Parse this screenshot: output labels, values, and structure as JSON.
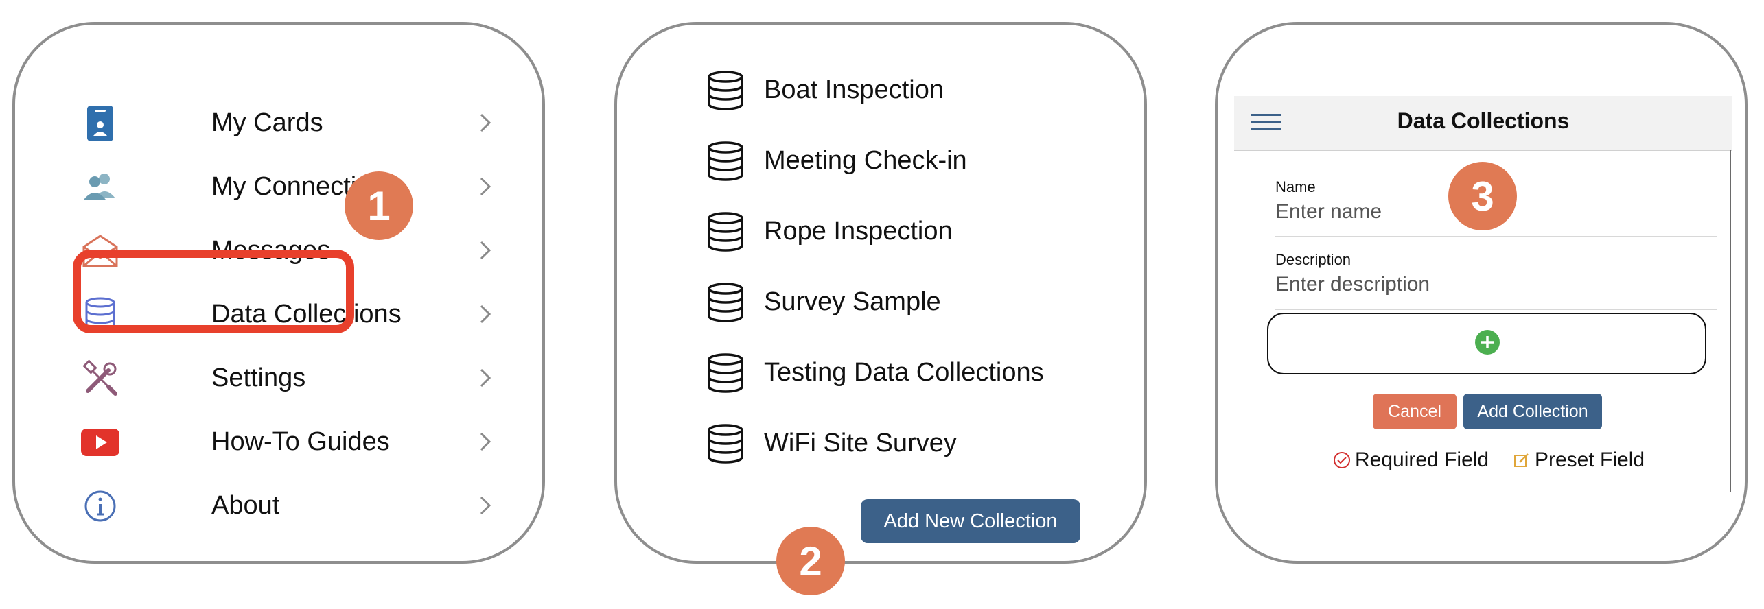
{
  "colors": {
    "callout": "#e07a54",
    "highlight": "#e8402c",
    "primary_button": "#3c6189",
    "cancel_button": "#df7457",
    "plus": "#4caf50"
  },
  "panel1": {
    "menu": [
      {
        "label": "My Cards",
        "icon": "id-card-icon"
      },
      {
        "label": "My Connections",
        "icon": "people-icon"
      },
      {
        "label": "Messages",
        "icon": "envelope-icon"
      },
      {
        "label": "Data Collections",
        "icon": "database-icon",
        "highlighted": true
      },
      {
        "label": "Settings",
        "icon": "tools-icon"
      },
      {
        "label": "How-To Guides",
        "icon": "youtube-play-icon"
      },
      {
        "label": "About",
        "icon": "info-icon"
      }
    ],
    "callout": "1"
  },
  "panel2": {
    "collections": [
      "Boat Inspection",
      "Meeting Check-in",
      "Rope Inspection",
      "Survey Sample",
      "Testing Data Collections",
      "WiFi Site Survey"
    ],
    "add_button": "Add New Collection",
    "callout": "2"
  },
  "panel3": {
    "title": "Data Collections",
    "name_label": "Name",
    "name_placeholder": "Enter name",
    "description_label": "Description",
    "description_placeholder": "Enter description",
    "cancel_label": "Cancel",
    "add_label": "Add Collection",
    "legend_required": "Required Field",
    "legend_preset": "Preset Field",
    "callout": "3"
  }
}
